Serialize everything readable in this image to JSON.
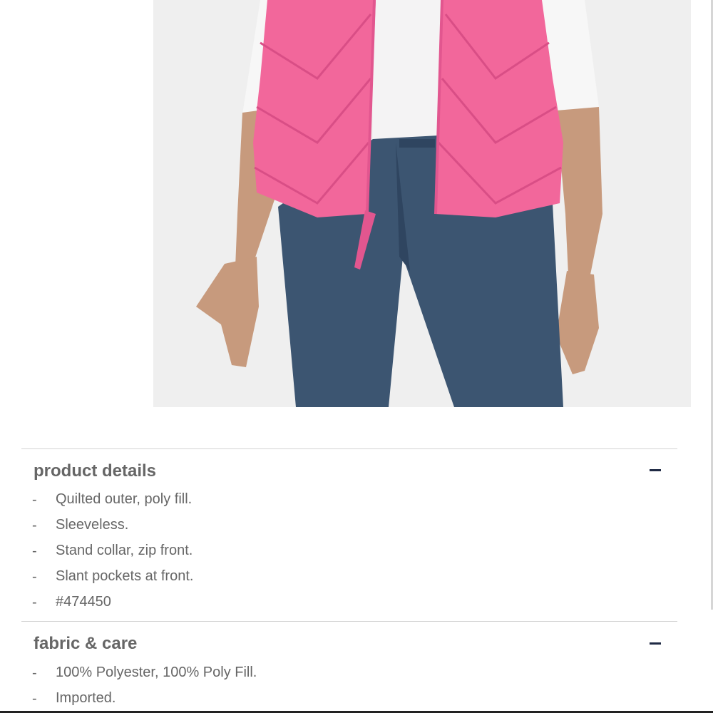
{
  "product_image": {
    "alt": "Model wearing pink quilted puffer vest with zip front over white long-sleeve top and dark wash jeans",
    "colors": {
      "background": "#efefef",
      "vest": "#f2679b",
      "shirt": "#f4f3f4",
      "jeans": "#3c5571",
      "skin": "#c79a7d"
    }
  },
  "sections": [
    {
      "title": "product details",
      "toggle_icon": "minus-icon",
      "items": [
        {
          "dash": "-",
          "text": "Quilted outer, poly fill."
        },
        {
          "dash": "-",
          "text": "Sleeveless."
        },
        {
          "dash": "-",
          "text": "Stand collar, zip front."
        },
        {
          "dash": "-",
          "text": "Slant pockets at front."
        },
        {
          "dash": "-",
          "text": "#474450"
        }
      ]
    },
    {
      "title": "fabric & care",
      "toggle_icon": "minus-icon",
      "items": [
        {
          "dash": "-",
          "text": "100% Polyester, 100% Poly Fill."
        },
        {
          "dash": "-",
          "text": "Imported."
        }
      ]
    }
  ]
}
